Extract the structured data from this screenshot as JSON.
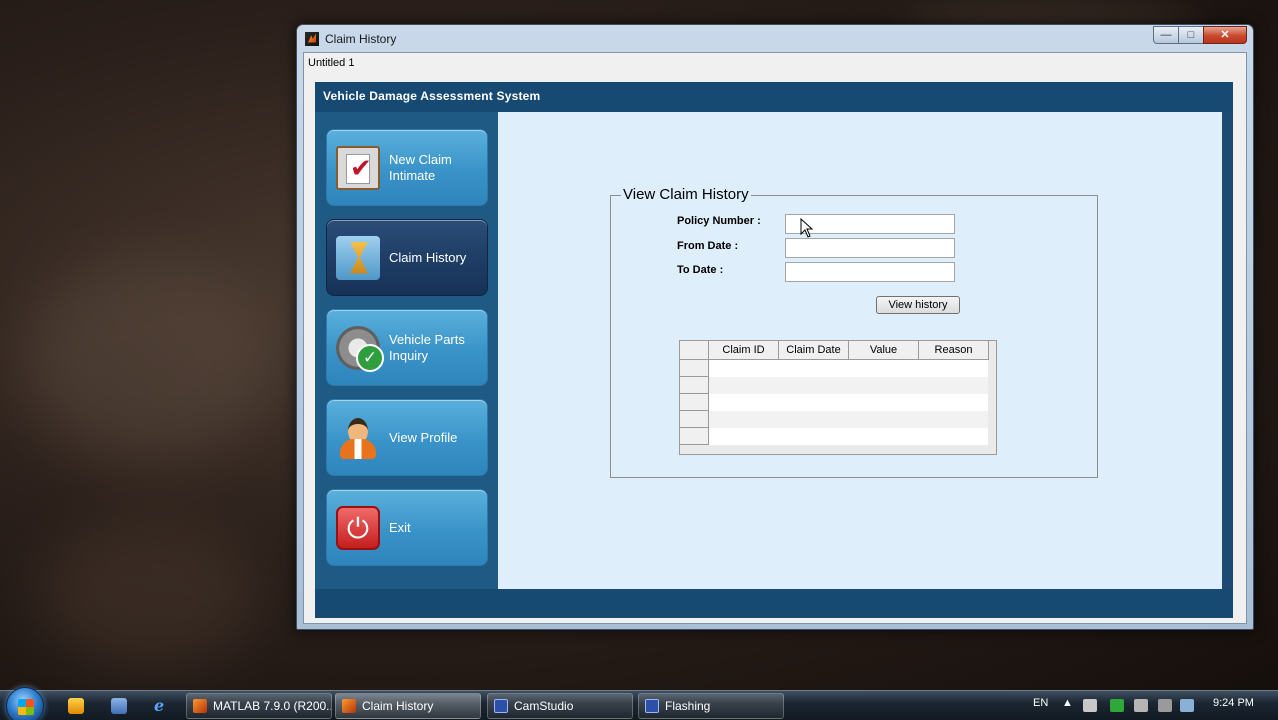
{
  "window": {
    "title": "Claim History",
    "menu_label": "Untitled 1",
    "controls": {
      "minimize": "—",
      "maximize": "□",
      "close": "✕"
    }
  },
  "app": {
    "header_title": "Vehicle Damage Assessment System"
  },
  "sidebar": {
    "items": [
      {
        "label": "New Claim Intimate",
        "icon": "clipboard-check-icon",
        "active": false
      },
      {
        "label": "Claim History",
        "icon": "hourglass-icon",
        "active": true
      },
      {
        "label": "Vehicle Parts Inquiry",
        "icon": "gear-check-icon",
        "active": false
      },
      {
        "label": "View Profile",
        "icon": "user-icon",
        "active": false
      },
      {
        "label": "Exit",
        "icon": "power-icon",
        "active": false
      }
    ]
  },
  "form": {
    "group_title": "View Claim History",
    "fields": [
      {
        "label": "Policy Number :",
        "value": ""
      },
      {
        "label": "From Date :",
        "value": ""
      },
      {
        "label": "To Date :",
        "value": ""
      }
    ],
    "button_label": "View history"
  },
  "table": {
    "columns": [
      "Claim ID",
      "Claim Date",
      "Value",
      "Reason"
    ],
    "rows": [
      [
        "",
        "",
        "",
        ""
      ],
      [
        "",
        "",
        "",
        ""
      ],
      [
        "",
        "",
        "",
        ""
      ],
      [
        "",
        "",
        "",
        ""
      ],
      [
        "",
        "",
        "",
        ""
      ]
    ]
  },
  "taskbar": {
    "tasks": [
      {
        "label": "MATLAB 7.9.0 (R200...",
        "icon": "matlab-icon",
        "active": false
      },
      {
        "label": "Claim History",
        "icon": "matlab-icon",
        "active": true
      },
      {
        "label": "CamStudio",
        "icon": "camstudio-icon",
        "active": false
      },
      {
        "label": "Flashing",
        "icon": "camstudio-icon",
        "active": false
      }
    ],
    "language": "EN",
    "clock": "9:24 PM"
  },
  "colors": {
    "header_bar": "#174a73",
    "content_bg": "#dfeefb",
    "nav_button": "#3a93c8",
    "nav_active": "#1d3b63"
  }
}
